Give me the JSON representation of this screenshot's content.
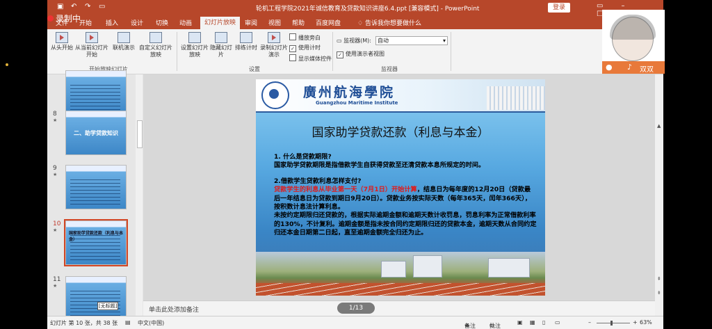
{
  "window": {
    "title": "轮机工程学院2021年诚信教育及贷款知识讲座6.4.ppt [兼容模式] - PowerPoint",
    "login_label": "登录",
    "recording_label": "录制中"
  },
  "tabs": [
    "文件",
    "开始",
    "插入",
    "设计",
    "切换",
    "动画",
    "幻灯片放映",
    "审阅",
    "视图",
    "帮助",
    "百度网盘",
    "告诉我你想要做什么"
  ],
  "active_tab": "幻灯片放映",
  "ribbon": {
    "start_group": {
      "label": "开始放映幻灯片",
      "buttons": [
        "从头开始",
        "从当前幻灯片开始",
        "联机演示",
        "自定义幻灯片放映"
      ]
    },
    "setup_group": {
      "label": "设置",
      "buttons": [
        "设置幻灯片放映",
        "隐藏幻灯片",
        "排练计时",
        "录制幻灯片演示"
      ],
      "checks": [
        {
          "label": "播放旁白",
          "checked": false
        },
        {
          "label": "使用计时",
          "checked": true
        },
        {
          "label": "显示媒体控件",
          "checked": false
        }
      ]
    },
    "monitor_group": {
      "label": "监视器",
      "monitor_label": "监视器(M):",
      "monitor_value": "自动",
      "presenter_view_label": "使用演示者视图",
      "presenter_view_checked": true
    }
  },
  "thumbnails": [
    {
      "num": "8",
      "title": "二、助学贷款知识"
    },
    {
      "num": "9",
      "title": ""
    },
    {
      "num": "10",
      "title": "国家助学贷款还款（利息与本金）"
    },
    {
      "num": "11",
      "title": ""
    }
  ],
  "thumb_tag": "[无标题]",
  "slide": {
    "school_cn": "廣州航海學院",
    "school_en": "Guangzhou Maritime Institute",
    "title": "国家助学贷款还款（利息与本金）",
    "q1": "1. 什么是贷款期限?",
    "a1": "国家助学贷款期限是指借款学生自获得贷款至还清贷款本息所规定的时间。",
    "q2": "2.借款学生贷款利息怎样支付?",
    "a2_red": "贷款学生的利息从毕业第一天（7月1日）开始计算",
    "a2_rest": "，结息日为每年度的12月20日（贷款最后一年结息日为贷款到期日9月20日）。贷款业务按实际天数（每年365天，闰年366天），按积数计息法计算利息。",
    "a3": "未按约定期限归还贷款的，根据实际逾期金额和逾期天数计收罚息，罚息利率为正常借款利率的130%，不计复利。逾期金额是指未按合同约定期限归还的贷款本金，逾期天数从合同约定归还本金日期第二日起，直至逾期金额完全归还为止。"
  },
  "notes_placeholder": "单击此处添加备注",
  "pager": "1/13",
  "status": {
    "slide_info": "幻灯片 第 10 张，共 38 张",
    "language": "中文(中国)",
    "notes": "备注",
    "comments": "批注",
    "zoom": "63%"
  },
  "video": {
    "user_name": "双双"
  }
}
